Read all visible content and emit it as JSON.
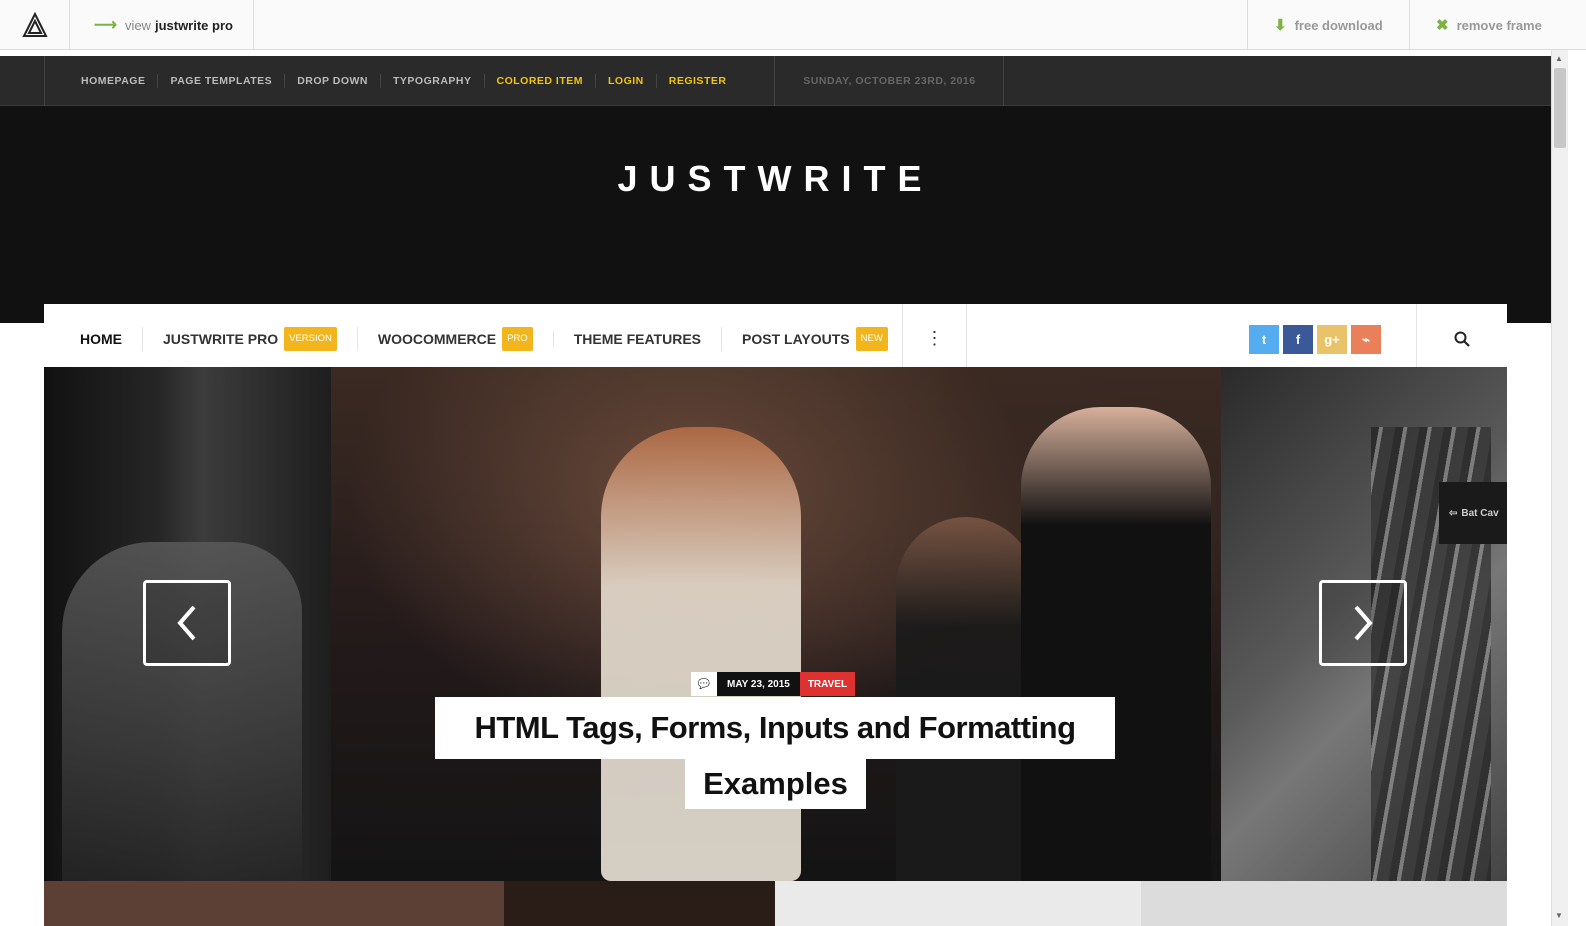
{
  "framebar": {
    "view_prefix": "view",
    "view_bold": "justwrite pro",
    "download_label": "free download",
    "remove_label": "remove frame"
  },
  "topbar": {
    "items": [
      "HOMEPAGE",
      "PAGE TEMPLATES",
      "DROP DOWN",
      "TYPOGRAPHY",
      "COLORED ITEM",
      "LOGIN",
      "REGISTER"
    ],
    "date": "SUNDAY, OCTOBER 23RD, 2016"
  },
  "header": {
    "logo": "JUSTWRITE"
  },
  "mainnav": {
    "items": [
      {
        "label": "HOME",
        "badge": ""
      },
      {
        "label": "JUSTWRITE PRO",
        "badge": "VERSION"
      },
      {
        "label": "WOOCOMMERCE",
        "badge": "PRO"
      },
      {
        "label": "THEME FEATURES",
        "badge": ""
      },
      {
        "label": "POST LAYOUTS",
        "badge": "NEW"
      }
    ],
    "social": [
      {
        "icon": "twitter-icon",
        "glyph": "t",
        "color": "#55acee"
      },
      {
        "icon": "facebook-icon",
        "glyph": "f",
        "color": "#3b5998"
      },
      {
        "icon": "google-plus-icon",
        "glyph": "g+",
        "color": "#e8c36a"
      },
      {
        "icon": "rss-icon",
        "glyph": "⌁",
        "color": "#e9805a"
      }
    ]
  },
  "slider": {
    "date": "MAY 23, 2015",
    "category": "TRAVEL",
    "title_line1": "HTML Tags, Forms, Inputs and Formatting",
    "title_line2": "Examples",
    "sign_text": "Bat Cav"
  },
  "colors": {
    "accent": "#f2b51b",
    "topbar": "#2a2a2a",
    "header": "#111111",
    "category": "#e03131",
    "highlight": "#f1c40f"
  }
}
